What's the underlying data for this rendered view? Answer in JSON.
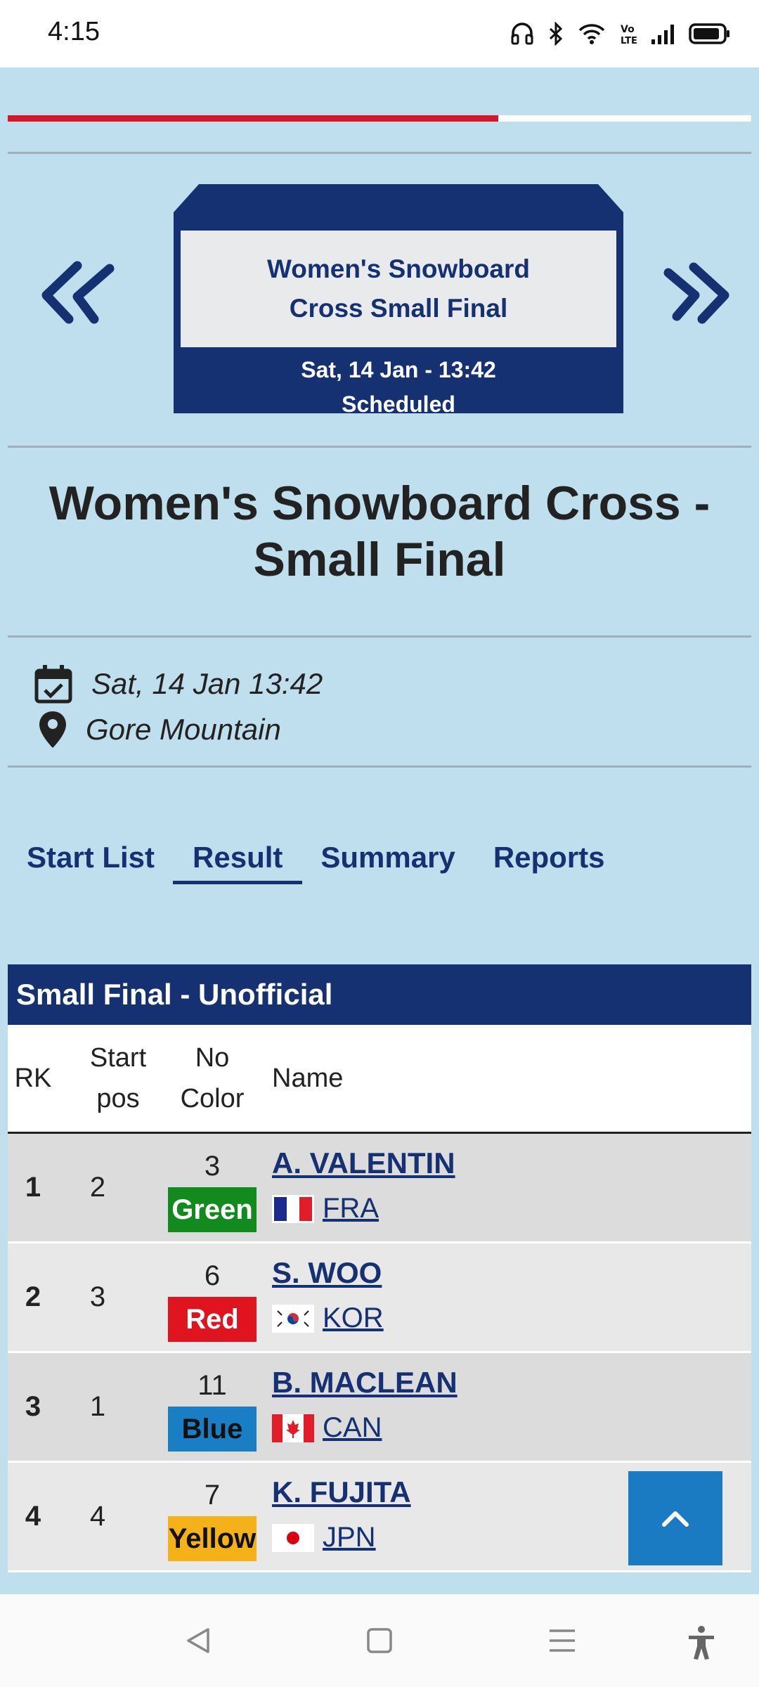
{
  "status_bar": {
    "time": "4:15"
  },
  "progress_percent": 66,
  "event_card": {
    "title": "Women's Snowboard Cross Small Final",
    "datetime": "Sat, 14 Jan - 13:42",
    "status": "Scheduled"
  },
  "page_title": "Women's Snowboard Cross - Small Final",
  "info": {
    "date": "Sat, 14 Jan 13:42",
    "venue": "Gore Mountain"
  },
  "tabs": [
    {
      "label": "Start List",
      "active": false
    },
    {
      "label": "Result",
      "active": true
    },
    {
      "label": "Summary",
      "active": false
    },
    {
      "label": "Reports",
      "active": false
    }
  ],
  "results": {
    "header": "Small Final  -  Unofficial",
    "columns": {
      "rk": "RK",
      "start_pos_1": "Start",
      "start_pos_2": "pos",
      "no_1": "No",
      "no_2": "Color",
      "name": "Name"
    },
    "rows": [
      {
        "rk": "1",
        "start_pos": "2",
        "no": "3",
        "color": "Green",
        "color_hex": "#128a1e",
        "color_text": "#ffffff",
        "name": "A. VALENTIN",
        "nation": "FRA"
      },
      {
        "rk": "2",
        "start_pos": "3",
        "no": "6",
        "color": "Red",
        "color_hex": "#e0141e",
        "color_text": "#ffffff",
        "name": "S. WOO",
        "nation": "KOR"
      },
      {
        "rk": "3",
        "start_pos": "1",
        "no": "11",
        "color": "Blue",
        "color_hex": "#1a7ec4",
        "color_text": "#111111",
        "name": "B. MACLEAN",
        "nation": "CAN"
      },
      {
        "rk": "4",
        "start_pos": "4",
        "no": "7",
        "color": "Yellow",
        "color_hex": "#f5b218",
        "color_text": "#111111",
        "name": "K. FUJITA",
        "nation": "JPN"
      }
    ]
  },
  "colors": {
    "navy": "#163172",
    "page_bg": "#c0dfee",
    "accent_red": "#d8162a",
    "scroll_button": "#1a7ac2"
  }
}
